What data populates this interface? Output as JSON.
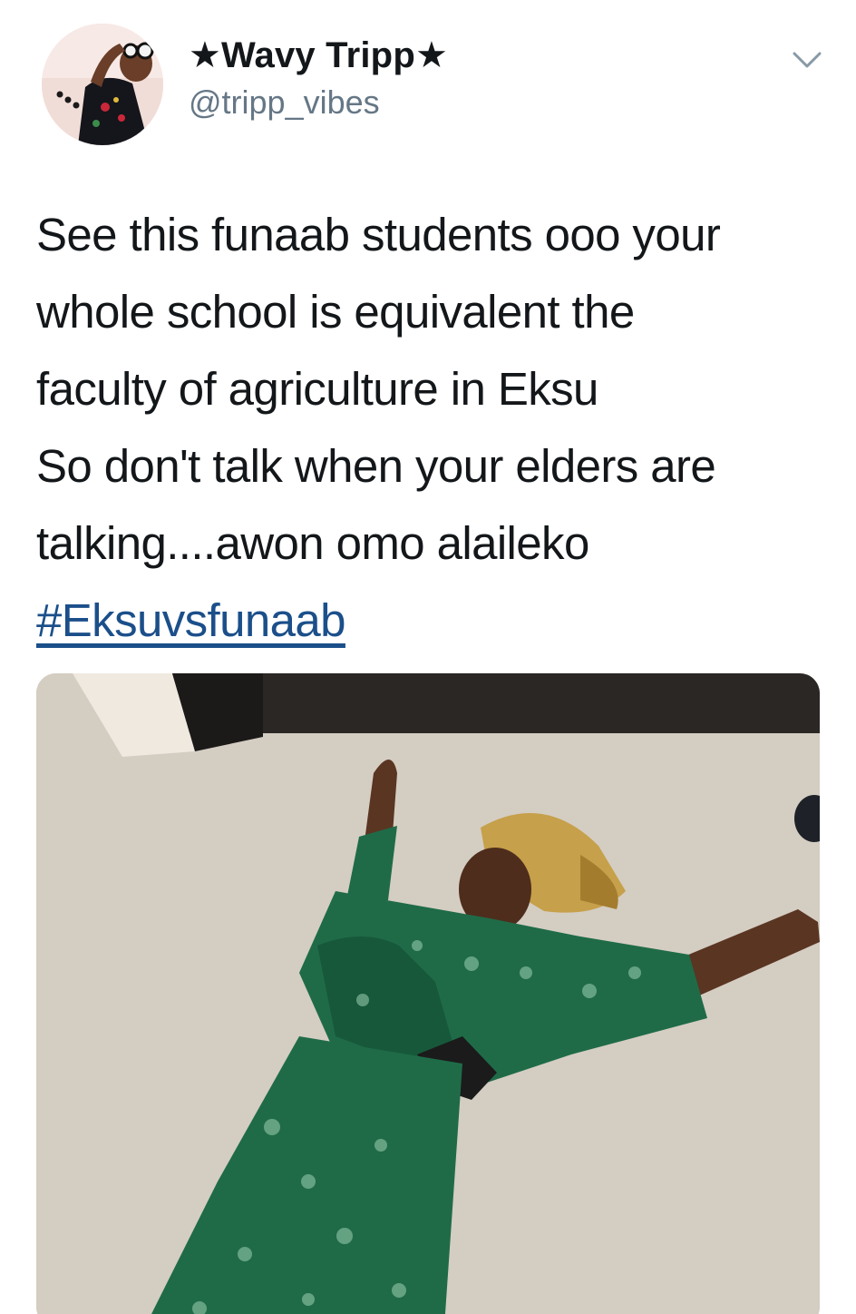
{
  "tweet": {
    "author": {
      "display_name": "★Wavy Tripp★",
      "handle": "@tripp_vibes",
      "avatar_icon": "profile-photo"
    },
    "menu_icon": "chevron-down-icon",
    "text_lines": [
      "See this funaab students ooo your",
      "whole school is equivalent the",
      "faculty of agriculture in Eksu",
      "So don't talk when your elders are",
      "talking....awon omo alaileko"
    ],
    "hashtag": "#Eksuvsfunaab",
    "media": {
      "description_icon": "photo-man-lying-on-carpet"
    }
  },
  "colors": {
    "text": "#14171a",
    "handle": "#657786",
    "hashtag": "#1b4f8a",
    "carpet": "#d6cfc6",
    "outfit_green": "#1f6b48"
  }
}
